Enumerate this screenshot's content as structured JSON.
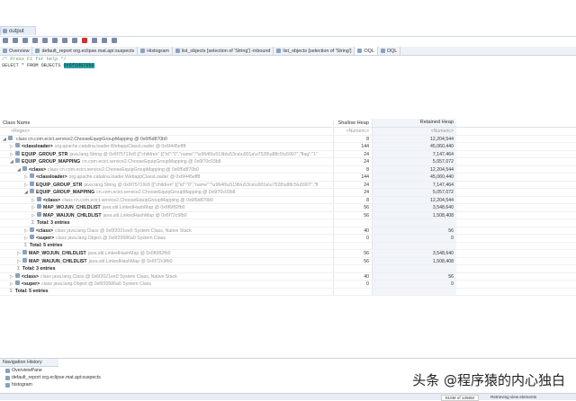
{
  "view_tab": {
    "label": "output"
  },
  "editor_tabs": [
    {
      "label": "Overview"
    },
    {
      "label": "default_report  org.eclipse.mat.api:suspects"
    },
    {
      "label": "Histogram"
    },
    {
      "label": "list_objects [selection of 'String'] -inbound"
    },
    {
      "label": "list_objects [selection of 'String']"
    },
    {
      "label": "OQL",
      "active": true
    },
    {
      "label": "OQL"
    }
  ],
  "query": {
    "comment": "/* Press F1 for help */",
    "text": "SELECT * FROM OBJECTS ",
    "highlight": "0x6f6d870b0"
  },
  "table": {
    "columns": [
      "Class Name",
      "Shallow Heap",
      "Retained Heap"
    ],
    "filter": [
      "<Regex>",
      "<Numeric>",
      "<Numeric>"
    ],
    "rows": [
      {
        "indent": 0,
        "exp": "open",
        "key": "",
        "name": "class cn.com.ecict.service2.ChooseEquipGroupMapping @ 0x6f6d870b0",
        "shallow": "8",
        "retained": "12,204,544"
      },
      {
        "indent": 1,
        "exp": "closed",
        "key": "<classloader>",
        "name": "org.apache.catalina.loader.WebappClassLoader @ 0x6f445eff8",
        "shallow": "144",
        "retained": "45,060,440"
      },
      {
        "indent": 1,
        "exp": "closed",
        "key": "EQUIP_GROUP_STR",
        "name": "java.lang.String @ 0x6f75719c8  [{\"children\":[{\"id\":\"0\",\"name\":\"\\u9646\\u519b\\u53ca\\u901a\\u7528\\u88c5\\u5907\",\"flag\":\"1\"",
        "shallow": "24",
        "retained": "7,147,464"
      },
      {
        "indent": 1,
        "exp": "open",
        "key": "EQUIP_GROUP_MAPPING",
        "name": "cn.com.ecict.service2.ChooseEquipGroupMapping @ 0x6f70c03b8",
        "shallow": "24",
        "retained": "5,057,072"
      },
      {
        "indent": 2,
        "exp": "open",
        "key": "<class>",
        "name": "class cn.com.ecict.service2.ChooseEquipGroupMapping @ 0x6f6d870b0",
        "shallow": "8",
        "retained": "12,204,544"
      },
      {
        "indent": 3,
        "exp": "closed",
        "key": "<classloader>",
        "name": "org.apache.catalina.loader.WebappClassLoader @ 0x6f445eff8",
        "shallow": "144",
        "retained": "45,060,440"
      },
      {
        "indent": 3,
        "exp": "closed",
        "key": "EQUIP_GROUP_STR",
        "name": "java.lang.String @ 0x6f75719c8  [{\"children\":[{\"id\":\"0\",\"name\":\"\\u9646\\u519b\\u53ca\\u901a\\u7528\\u88c5\\u5907\",\"fl",
        "shallow": "24",
        "retained": "7,147,464"
      },
      {
        "indent": 3,
        "exp": "open",
        "key": "EQUIP_GROUP_MAPPING",
        "name": "cn.com.ecict.service2.ChooseEquipGroupMapping @ 0x6f70c03b8",
        "shallow": "24",
        "retained": "5,057,072"
      },
      {
        "indent": 4,
        "exp": "closed",
        "key": "<class>",
        "name": "class cn.com.ecict.service2.ChooseEquipGroupMapping @ 0x6f6d870b0",
        "shallow": "8",
        "retained": "12,204,544"
      },
      {
        "indent": 4,
        "exp": "closed",
        "key": "MAP_WOJUN_CHILDLIST",
        "name": "java.util.LinkedHashMap @ 0x6f6f82fb0",
        "shallow": "56",
        "retained": "3,548,640"
      },
      {
        "indent": 4,
        "exp": "closed",
        "key": "MAP_WAIJUN_CHILDLIST",
        "name": "java.util.LinkedHashMap @ 0x6f72c9fb0",
        "shallow": "56",
        "retained": "1,508,408"
      },
      {
        "indent": 4,
        "total": true,
        "key": "Total: 3 entries",
        "name": "",
        "shallow": "",
        "retained": ""
      },
      {
        "indent": 3,
        "exp": "closed",
        "key": "<class>",
        "name": "class java.lang.Class @ 0x6f2021ee0 System Class, Native Stack",
        "shallow": "40",
        "retained": "56"
      },
      {
        "indent": 3,
        "exp": "closed",
        "key": "<super>",
        "name": "class java.lang.Object @ 0x6f20586a0 System Class",
        "shallow": "0",
        "retained": "0"
      },
      {
        "indent": 3,
        "total": true,
        "key": "Total: 5 entries",
        "name": "",
        "shallow": "",
        "retained": ""
      },
      {
        "indent": 2,
        "exp": "closed",
        "key": "MAP_WOJUN_CHILDLIST",
        "name": "java.util.LinkedHashMap @ 0x6f6f82fb0",
        "shallow": "56",
        "retained": "3,548,640"
      },
      {
        "indent": 2,
        "exp": "closed",
        "key": "MAP_WAIJUN_CHILDLIST",
        "name": "java.util.LinkedHashMap @ 0x6f72c9fb0",
        "shallow": "56",
        "retained": "1,508,408"
      },
      {
        "indent": 2,
        "total": true,
        "key": "Total: 3 entries",
        "name": "",
        "shallow": "",
        "retained": ""
      },
      {
        "indent": 1,
        "exp": "closed",
        "key": "<class>",
        "name": "class java.lang.Class @ 0x6f2021ee0 System Class, Native Stack",
        "shallow": "40",
        "retained": "56"
      },
      {
        "indent": 1,
        "exp": "closed",
        "key": "<super>",
        "name": "class java.lang.Object @ 0x6f20586a0 System Class",
        "shallow": "0",
        "retained": "0"
      },
      {
        "indent": 1,
        "total": true,
        "key": "Total: 5 entries",
        "name": "",
        "shallow": "",
        "retained": ""
      }
    ]
  },
  "navigation": {
    "title": "Navigation History",
    "items": [
      "OverviewPane",
      "default_report  org.eclipse.mat.api:suspects",
      "histogram"
    ]
  },
  "status": {
    "memory": "815M of 1356M",
    "message": "Retrieving view elements"
  },
  "watermark": "头条 @程序猿的内心独白"
}
